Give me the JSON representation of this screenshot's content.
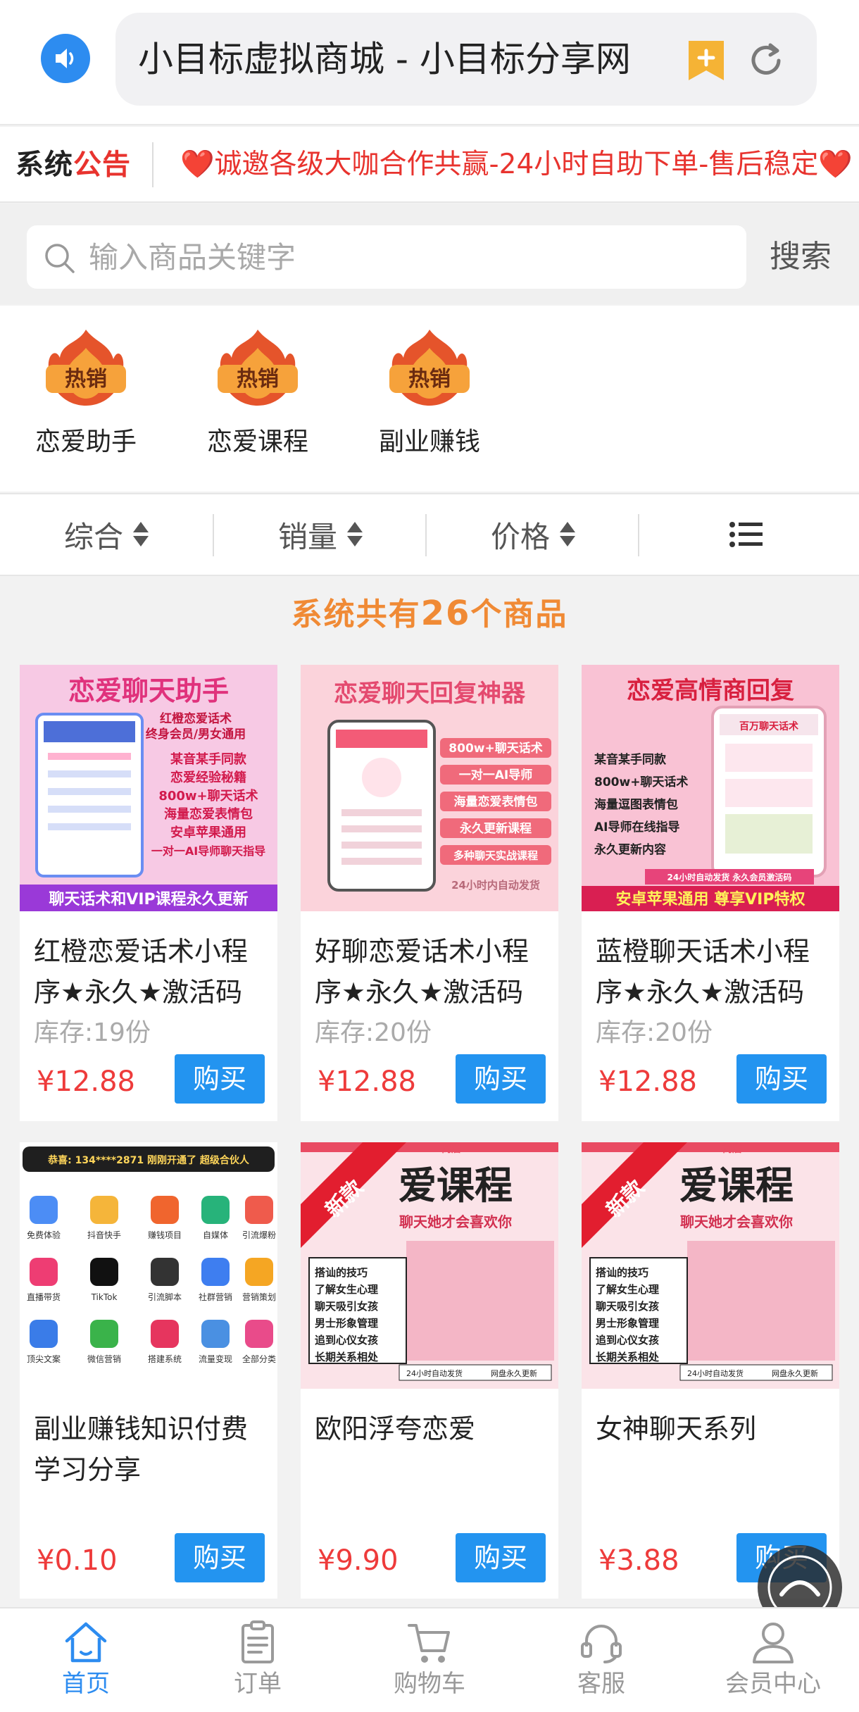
{
  "browser": {
    "url_title": "小目标虚拟商城 - 小目标分享网"
  },
  "notice": {
    "title_a": "系统",
    "title_b": "公告",
    "text": "❤️诚邀各级大咖合作共赢-24小时自助下单-售后稳定❤️"
  },
  "search": {
    "placeholder": "输入商品关键字",
    "button": "搜索"
  },
  "categories": [
    {
      "badge": "热销",
      "label": "恋爱助手"
    },
    {
      "badge": "热销",
      "label": "恋爱课程"
    },
    {
      "badge": "热销",
      "label": "副业赚钱"
    }
  ],
  "sort": {
    "items": [
      "综合",
      "销量",
      "价格"
    ],
    "list_icon": "list-icon"
  },
  "count": {
    "prefix": "系统共有",
    "number": "26",
    "suffix": "个商品"
  },
  "products": [
    {
      "name": "红橙恋爱话术小程序★永久★激活码",
      "stock": "库存:19份",
      "price": "¥12.88",
      "buy": "购买",
      "banner": {
        "title": "恋爱聊天助手",
        "sub1": "红橙恋爱话术",
        "sub2": "终身会员/男女通用",
        "lines": [
          "某音某手同款",
          "恋爱经验秘籍",
          "800w+聊天话术",
          "海量恋爱表情包",
          "安卓苹果通用",
          "一对一AI导师聊天指导"
        ],
        "footer": "聊天话术和VIP课程永久更新"
      }
    },
    {
      "name": "好聊恋爱话术小程序★永久★激活码",
      "stock": "库存:20份",
      "price": "¥12.88",
      "buy": "购买",
      "banner": {
        "title": "恋爱聊天回复神器",
        "lines": [
          "800w+聊天话术",
          "一对一AI导师",
          "海量恋爱表情包",
          "永久更新课程",
          "多种聊天实战课程"
        ],
        "footer": "24小时内自动发货"
      }
    },
    {
      "name": "蓝橙聊天话术小程序★永久★激活码",
      "stock": "库存:20份",
      "price": "¥12.88",
      "buy": "购买",
      "banner": {
        "title": "恋爱高情商回复",
        "tag": "百万聊天话术",
        "lines": [
          "某音某手同款",
          "800w+聊天话术",
          "海量逗图表情包",
          "AI导师在线指导",
          "永久更新内容"
        ],
        "note": "24小时自动发货 永久会员激活码",
        "footer": "安卓苹果通用 尊享VIP特权"
      }
    },
    {
      "name": "副业赚钱知识付费学习分享",
      "stock": "",
      "price": "¥0.10",
      "buy": "购买",
      "banner": {
        "ticker": "恭喜: 134****2871 刚刚开通了 超级合伙人",
        "apps": [
          "免费体验",
          "抖音快手",
          "赚钱项目",
          "自媒体",
          "引流爆粉",
          "直播带货",
          "TikTok",
          "引流脚本",
          "社群营销",
          "营销策划",
          "顶尖文案",
          "微信营销",
          "搭建系统",
          "流量变现",
          "全部分类"
        ]
      }
    },
    {
      "name": "欧阳浮夸恋爱",
      "stock": "",
      "price": "¥9.90",
      "buy": "购买",
      "banner": {
        "ribbon": "新款",
        "shop": "商店",
        "title": "爱课程",
        "subtitle": "聊天她才会喜欢你",
        "lines": [
          "搭讪的技巧",
          "了解女生心理",
          "聊天吸引女孩",
          "男士形象管理",
          "追到心仪女孩",
          "长期关系相处"
        ],
        "footer_left": "24小时自动发货",
        "footer_right": "网盘永久更新"
      }
    },
    {
      "name": "女神聊天系列",
      "stock": "",
      "price": "¥3.88",
      "buy": "购买",
      "banner": {
        "ribbon": "新款",
        "shop": "商店",
        "title": "爱课程",
        "subtitle": "聊天她才会喜欢你",
        "lines": [
          "搭讪的技巧",
          "了解女生心理",
          "聊天吸引女孩",
          "男士形象管理",
          "追到心仪女孩",
          "长期关系相处"
        ],
        "footer_left": "24小时自动发货",
        "footer_right": "网盘永久更新"
      }
    }
  ],
  "nav": [
    {
      "label": "首页",
      "icon": "home-icon",
      "active": true
    },
    {
      "label": "订单",
      "icon": "order-icon",
      "active": false
    },
    {
      "label": "购物车",
      "icon": "cart-icon",
      "active": false
    },
    {
      "label": "客服",
      "icon": "headset-icon",
      "active": false
    },
    {
      "label": "会员中心",
      "icon": "user-icon",
      "active": false
    }
  ],
  "colors": {
    "accent_blue": "#2d8cf0",
    "price_red": "#ee3b3b",
    "count_orange": "#f08a35",
    "notice_red": "#e8332e"
  }
}
